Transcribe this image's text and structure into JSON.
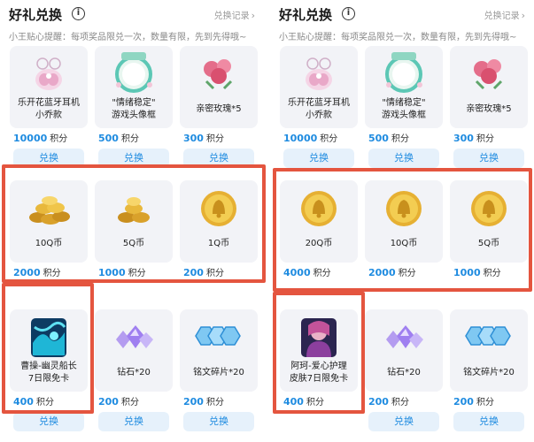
{
  "colors": {
    "accent": "#1e8be0",
    "highlight": "#e4553f",
    "card_bg": "#f2f3f7"
  },
  "panels": [
    {
      "title": "好礼兑换",
      "info_icon": "ⓘ",
      "record_link": "兑换记录",
      "tip": "小王贴心提醒：每项奖品限兑一次，数量有限，先到先得哦~",
      "items": [
        {
          "name1": "乐开花蓝牙耳机",
          "name2": "小乔款",
          "price": "10000",
          "unit": "积分",
          "button": "兑换",
          "icon": "headphones-icon"
        },
        {
          "name1": "\"情绪稳定\"",
          "name2": "游戏头像框",
          "price": "500",
          "unit": "积分",
          "button": "兑换",
          "icon": "avatar-frame-icon"
        },
        {
          "name1": "亲密玫瑰*5",
          "name2": "",
          "price": "300",
          "unit": "积分",
          "button": "兑换",
          "icon": "rose-icon"
        },
        {
          "name1": "10Q币",
          "name2": "",
          "price": "2000",
          "unit": "积分",
          "button": "",
          "icon": "coin-pile-icon"
        },
        {
          "name1": "5Q币",
          "name2": "",
          "price": "1000",
          "unit": "积分",
          "button": "",
          "icon": "coin-pile-icon"
        },
        {
          "name1": "1Q币",
          "name2": "",
          "price": "200",
          "unit": "积分",
          "button": "",
          "icon": "coin-icon"
        },
        {
          "name1": "曹操-幽灵船长",
          "name2": "7日限免卡",
          "price": "400",
          "unit": "积分",
          "button": "兑换",
          "icon": "skin-card-icon"
        },
        {
          "name1": "钻石*20",
          "name2": "",
          "price": "200",
          "unit": "积分",
          "button": "兑换",
          "icon": "diamond-icon"
        },
        {
          "name1": "铭文碎片*20",
          "name2": "",
          "price": "200",
          "unit": "积分",
          "button": "兑换",
          "icon": "inscription-shard-icon"
        }
      ]
    },
    {
      "title": "好礼兑换",
      "info_icon": "ⓘ",
      "record_link": "兑换记录",
      "tip": "小王贴心提醒：每项奖品限兑一次，数量有限，先到先得哦~",
      "items": [
        {
          "name1": "乐开花蓝牙耳机",
          "name2": "小乔款",
          "price": "10000",
          "unit": "积分",
          "button": "兑换",
          "icon": "headphones-icon"
        },
        {
          "name1": "\"情绪稳定\"",
          "name2": "游戏头像框",
          "price": "500",
          "unit": "积分",
          "button": "兑换",
          "icon": "avatar-frame-icon"
        },
        {
          "name1": "亲密玫瑰*5",
          "name2": "",
          "price": "300",
          "unit": "积分",
          "button": "兑换",
          "icon": "rose-icon"
        },
        {
          "name1": "20Q币",
          "name2": "",
          "price": "4000",
          "unit": "积分",
          "button": "",
          "icon": "coin-icon"
        },
        {
          "name1": "10Q币",
          "name2": "",
          "price": "2000",
          "unit": "积分",
          "button": "",
          "icon": "coin-icon"
        },
        {
          "name1": "5Q币",
          "name2": "",
          "price": "1000",
          "unit": "积分",
          "button": "",
          "icon": "coin-icon"
        },
        {
          "name1": "阿珂-爱心护理",
          "name2": "皮肤7日限免卡",
          "price": "400",
          "unit": "积分",
          "button": "兑换",
          "icon": "skin-card-icon"
        },
        {
          "name1": "钻石*20",
          "name2": "",
          "price": "200",
          "unit": "积分",
          "button": "兑换",
          "icon": "diamond-icon"
        },
        {
          "name1": "铭文碎片*20",
          "name2": "",
          "price": "200",
          "unit": "积分",
          "button": "兑换",
          "icon": "inscription-shard-icon"
        }
      ]
    }
  ]
}
